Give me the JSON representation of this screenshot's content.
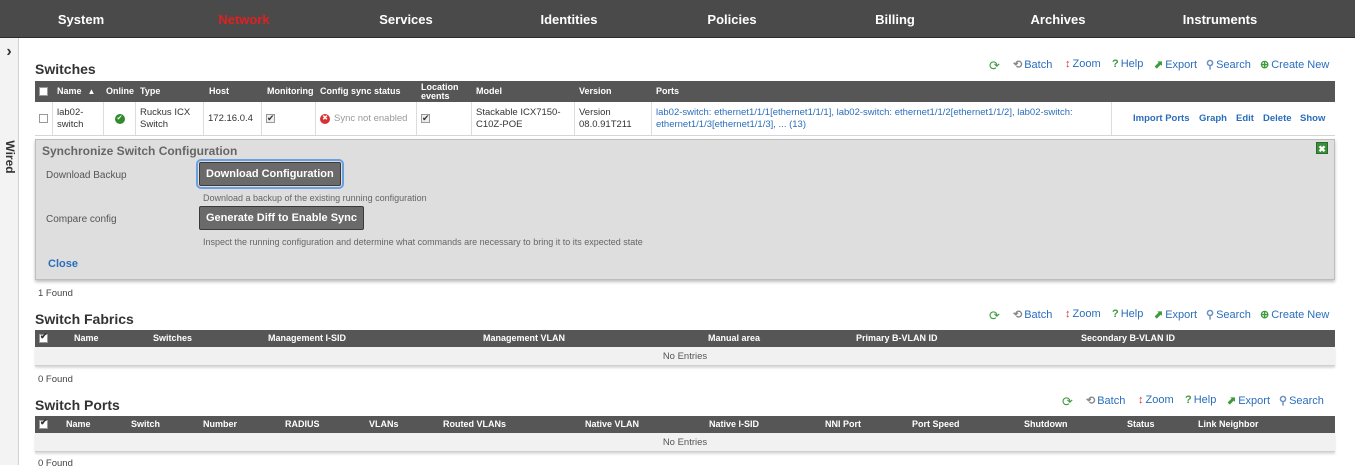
{
  "nav": {
    "items": [
      {
        "label": "System",
        "active": false
      },
      {
        "label": "Network",
        "active": true
      },
      {
        "label": "Services",
        "active": false
      },
      {
        "label": "Identities",
        "active": false
      },
      {
        "label": "Policies",
        "active": false
      },
      {
        "label": "Billing",
        "active": false
      },
      {
        "label": "Archives",
        "active": false
      },
      {
        "label": "Instruments",
        "active": false
      }
    ]
  },
  "sidebar": {
    "toggle_icon": "chevron-right-icon",
    "label": "Wired"
  },
  "colors": {
    "nav_bg": "#4a4a4a",
    "active_nav": "#e02020",
    "link": "#2a6ebb",
    "grid_header": "#565656"
  },
  "toolbar": {
    "refresh_icon": "refresh-icon",
    "batch": "Batch",
    "zoom": "Zoom",
    "help": "Help",
    "export": "Export",
    "search": "Search",
    "create_new": "Create New"
  },
  "switches": {
    "title": "Switches",
    "columns": {
      "name": "Name",
      "online": "Online",
      "type": "Type",
      "host": "Host",
      "monitoring": "Monitoring",
      "config_sync_status": "Config sync status",
      "location_events": "Location events",
      "model": "Model",
      "version": "Version",
      "ports": "Ports"
    },
    "row": {
      "name": "lab02-switch",
      "online": "online-check-icon",
      "type": "Ruckus ICX Switch",
      "host": "172.16.0.4",
      "monitoring": true,
      "config_sync_status": "Sync not enabled",
      "location_events": true,
      "model": "Stackable ICX7150-C10Z-POE",
      "version": "Version 08.0.91T211",
      "ports": "lab02-switch: ethernet1/1/1[ethernet1/1/1], lab02-switch: ethernet1/1/2[ethernet1/1/2], lab02-switch: ethernet1/1/3[ethernet1/1/3], ... (13)",
      "actions": {
        "import_ports": "Import Ports",
        "graph": "Graph",
        "edit": "Edit",
        "delete": "Delete",
        "show": "Show"
      }
    },
    "found": "1 Found"
  },
  "sync_panel": {
    "title": "Synchronize Switch Configuration",
    "download_label": "Download Backup",
    "download_button": "Download Configuration",
    "download_hint": "Download a backup of the existing running configuration",
    "compare_label": "Compare config",
    "compare_button": "Generate Diff to Enable Sync",
    "compare_hint": "Inspect the running configuration and determine what commands are necessary to bring it to its expected state",
    "close": "Close"
  },
  "fabrics": {
    "title": "Switch Fabrics",
    "columns": {
      "name": "Name",
      "switches": "Switches",
      "mgmt_isid": "Management I-SID",
      "mgmt_vlan": "Management VLAN",
      "manual_area": "Manual area",
      "primary_bvlan": "Primary B-VLAN ID",
      "secondary_bvlan": "Secondary B-VLAN ID"
    },
    "empty": "No Entries",
    "found": "0 Found"
  },
  "ports": {
    "title": "Switch Ports",
    "columns": {
      "name": "Name",
      "switch": "Switch",
      "number": "Number",
      "radius": "RADIUS",
      "vlans": "VLANs",
      "routed_vlans": "Routed VLANs",
      "native_vlan": "Native VLAN",
      "native_isid": "Native I-SID",
      "nni_port": "NNI Port",
      "port_speed": "Port Speed",
      "shutdown": "Shutdown",
      "status": "Status",
      "link_neighbor": "Link Neighbor"
    },
    "empty": "No Entries",
    "found": "0 Found"
  }
}
